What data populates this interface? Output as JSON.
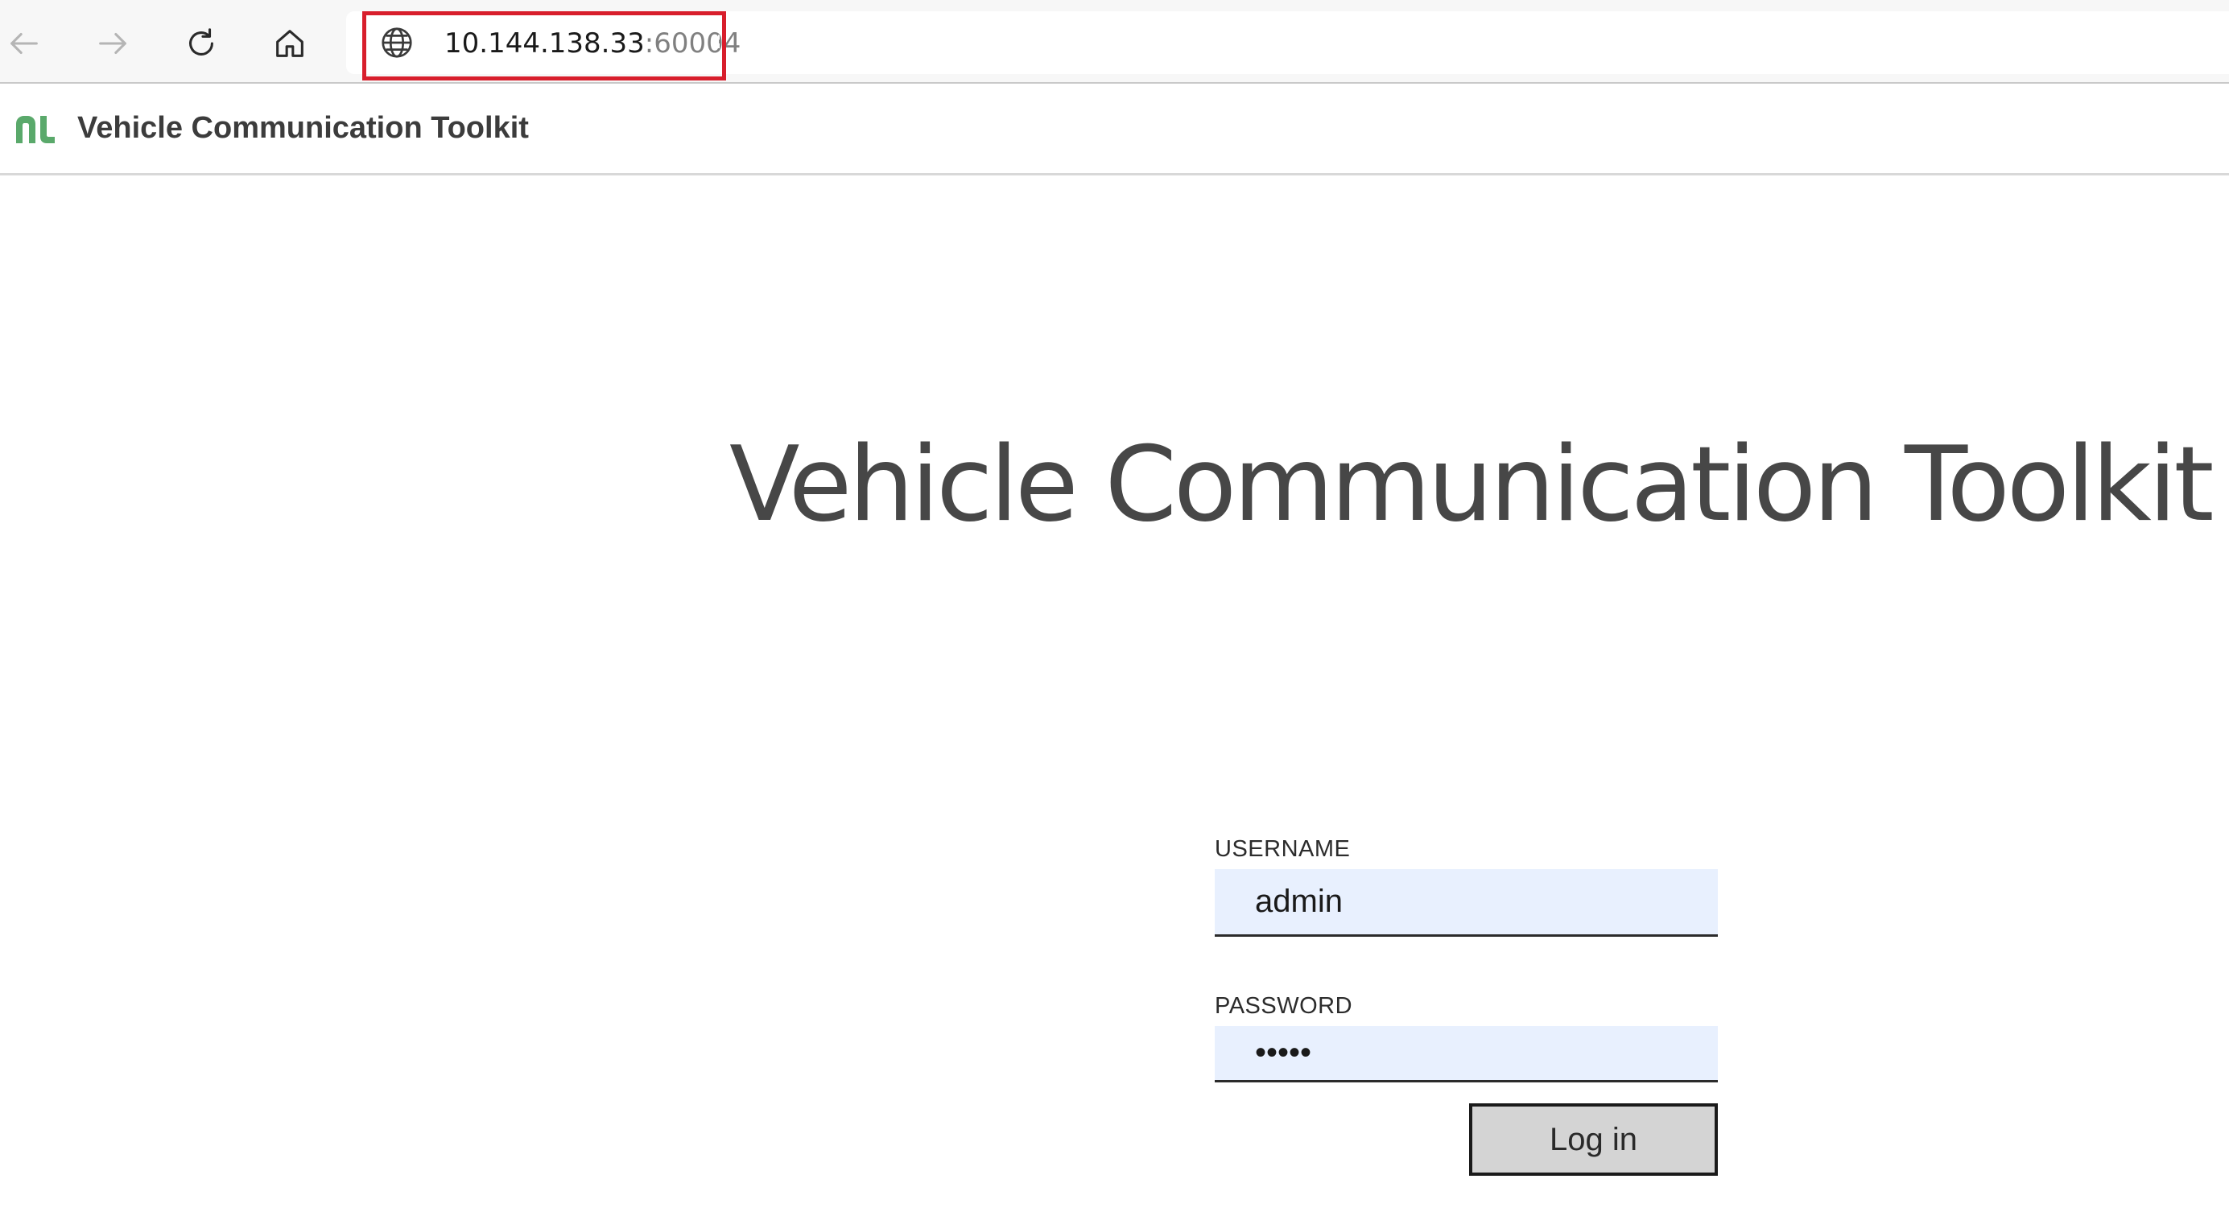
{
  "browser": {
    "url_host": "10.144.138.33",
    "url_port": ":60004"
  },
  "header": {
    "app_name": "Vehicle Communication Toolkit"
  },
  "hero": {
    "title": "Vehicle Communication Toolkit"
  },
  "login": {
    "username_label": "USERNAME",
    "username_value": "admin",
    "password_label": "PASSWORD",
    "password_value": "admin",
    "submit_label": "Log in"
  },
  "colors": {
    "brand_green": "#5aa96b",
    "highlight_red": "#d81e2c",
    "autofill_blue": "#e8f0fe"
  }
}
